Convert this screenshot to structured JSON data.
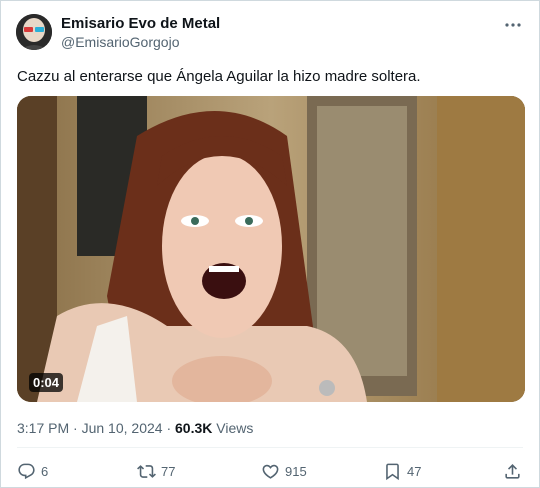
{
  "author": {
    "name": "Emisario Evo de Metal",
    "handle": "@EmisarioGorgojo"
  },
  "tweet": {
    "text": "Cazzu al enterarse que Ángela Aguilar la hizo madre soltera."
  },
  "media": {
    "duration": "0:04"
  },
  "meta": {
    "time": "3:17 PM",
    "separator": "·",
    "date": "Jun 10, 2024",
    "views_count": "60.3K",
    "views_label": "Views"
  },
  "actions": {
    "replies": "6",
    "reposts": "77",
    "likes": "915",
    "bookmarks": "47"
  },
  "icons": [
    "more-icon",
    "reply-icon",
    "repost-icon",
    "like-icon",
    "bookmark-icon",
    "share-icon"
  ]
}
